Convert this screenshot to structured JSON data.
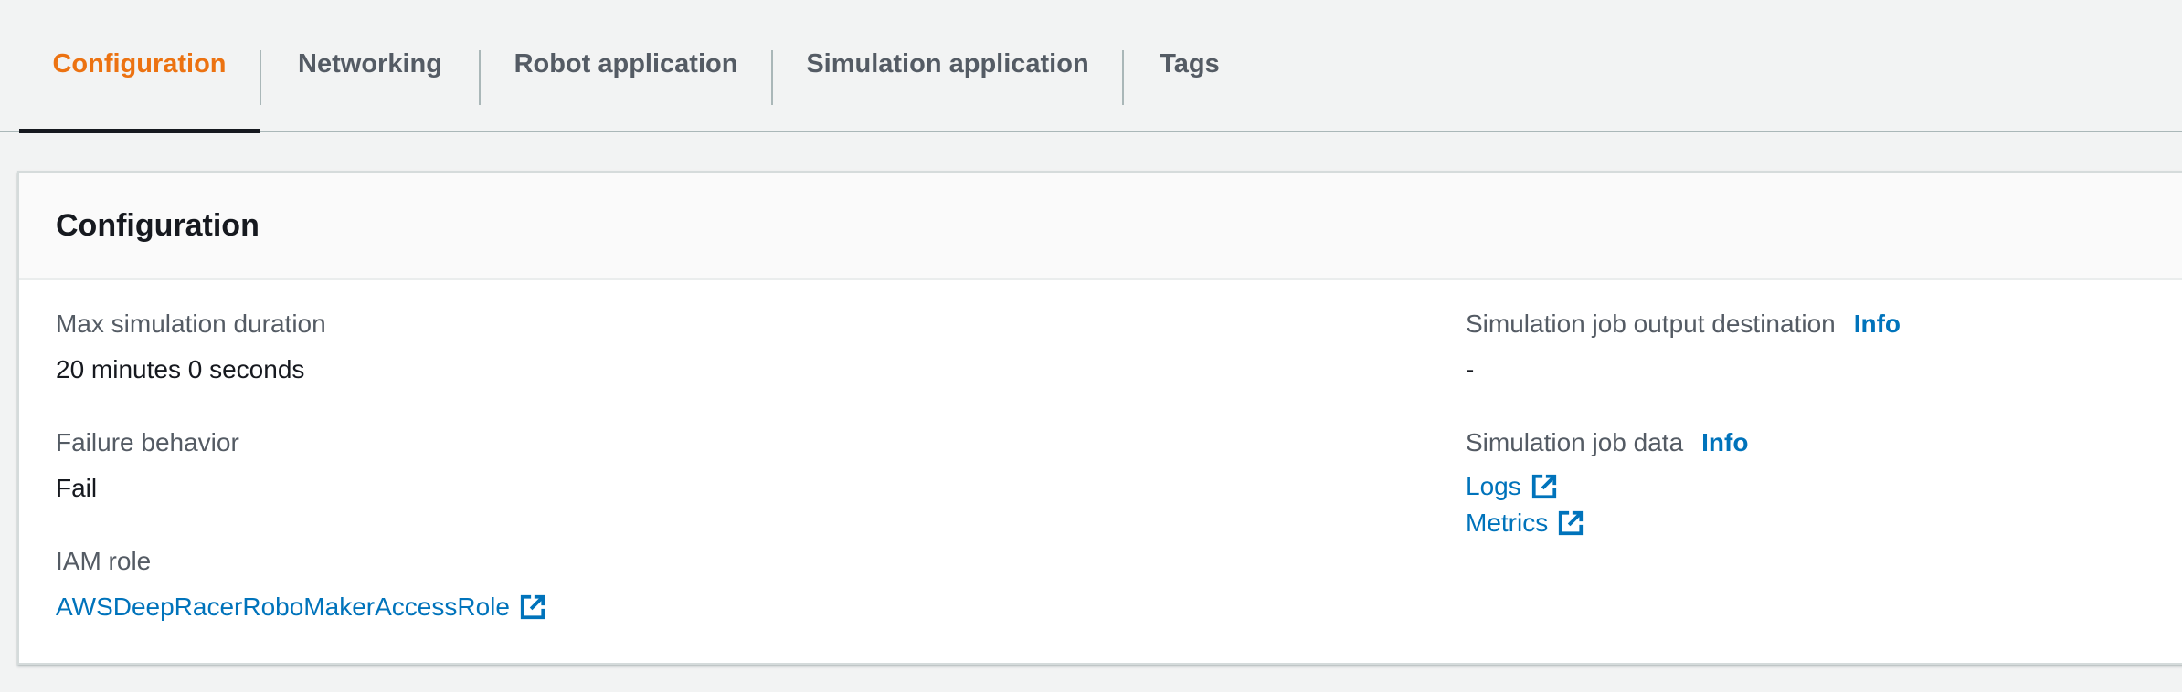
{
  "tabs": [
    {
      "label": "Configuration",
      "active": true
    },
    {
      "label": "Networking",
      "active": false
    },
    {
      "label": "Robot application",
      "active": false
    },
    {
      "label": "Simulation application",
      "active": false
    },
    {
      "label": "Tags",
      "active": false
    }
  ],
  "panel": {
    "title": "Configuration",
    "max_duration": {
      "label": "Max simulation duration",
      "value": "20 minutes 0 seconds"
    },
    "failure_behavior": {
      "label": "Failure behavior",
      "value": "Fail"
    },
    "iam_role": {
      "label": "IAM role",
      "value": "AWSDeepRacerRoboMakerAccessRole"
    },
    "output_destination": {
      "label": "Simulation job output destination",
      "info": "Info",
      "value": "-"
    },
    "job_data": {
      "label": "Simulation job data",
      "info": "Info",
      "links": [
        "Logs",
        "Metrics"
      ]
    }
  },
  "colors": {
    "active_tab": "#ec7211",
    "link": "#0073bb",
    "text": "#16191f",
    "label": "#545b64"
  },
  "icons": {
    "external_link": "external-link-icon"
  }
}
